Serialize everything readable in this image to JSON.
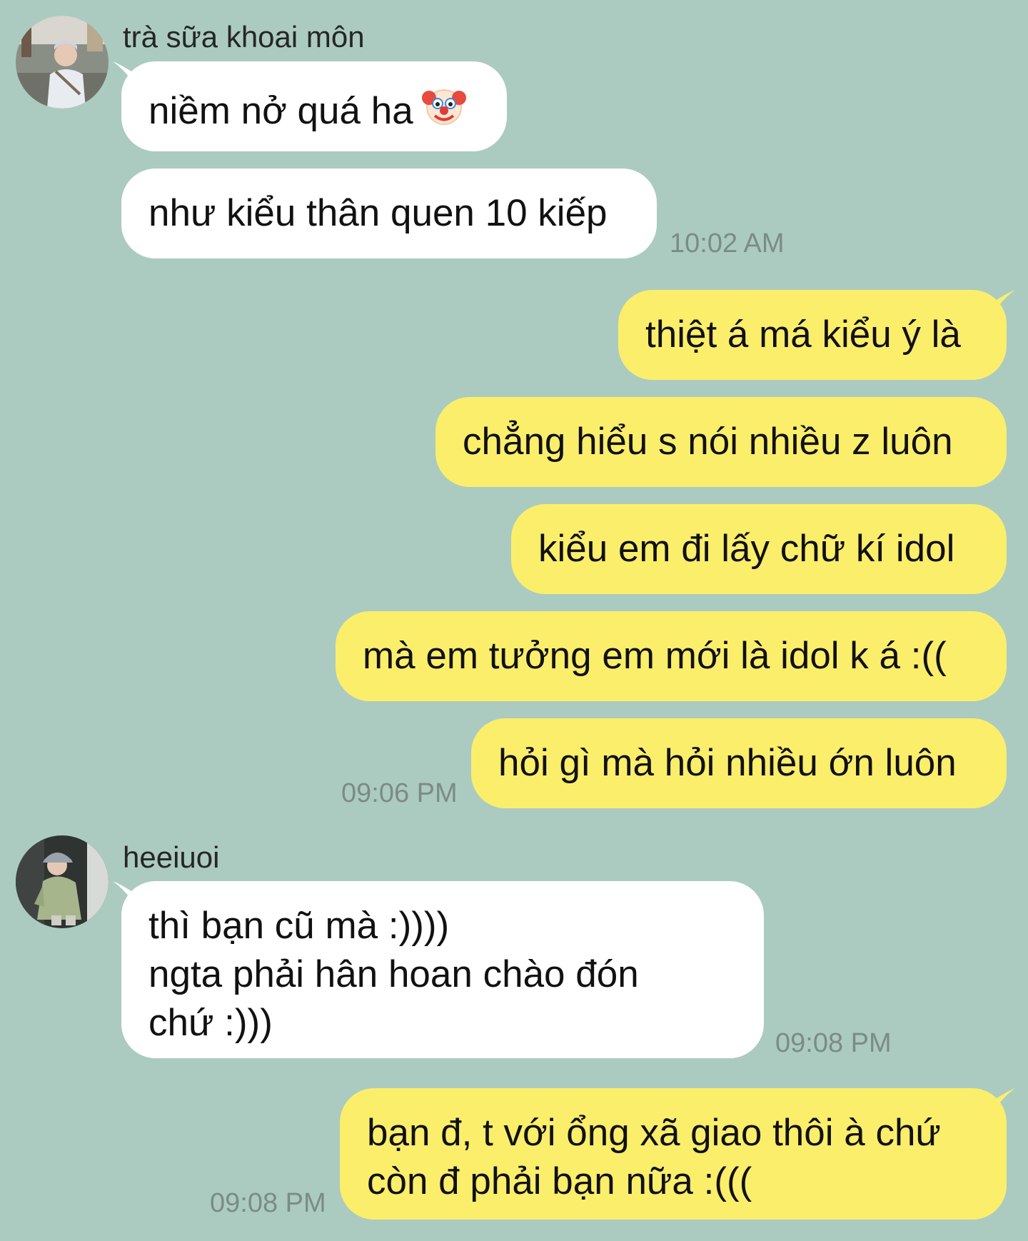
{
  "theme": {
    "background": "#abcbc1",
    "incoming_bubble": "#ffffff",
    "outgoing_bubble": "#fbee6b",
    "timestamp_color": "#7c8b86"
  },
  "messages": {
    "group1": {
      "sender": "trà sữa khoai môn",
      "avatar_icon": "user-avatar-photo",
      "m1": "niềm nở quá ha",
      "m1_emoji": "clown-face-emoji",
      "m2": "như kiểu thân quen 10 kiếp",
      "time": "10:02 AM"
    },
    "group2": {
      "m1": "thiệt á má kiểu ý là",
      "m2": "chẳng hiểu s nói nhiều z luôn",
      "m3": "kiểu em đi lấy chữ kí idol",
      "m4": "mà em tưởng em mới là idol k á :((",
      "m5": "hỏi gì mà hỏi nhiều ớn luôn",
      "time": "09:06 PM"
    },
    "group3": {
      "sender": "heeiuoi",
      "avatar_icon": "user-avatar-photo",
      "m1_line1": "thì bạn cũ mà :))))",
      "m1_line2": "ngta phải hân hoan chào đón",
      "m1_line3": "chứ :)))",
      "time": "09:08 PM"
    },
    "group4": {
      "m1_line1": "bạn đ, t với ổng xã giao thôi à chứ",
      "m1_line2": "còn đ phải bạn nữa :(((",
      "time": "09:08 PM"
    }
  }
}
